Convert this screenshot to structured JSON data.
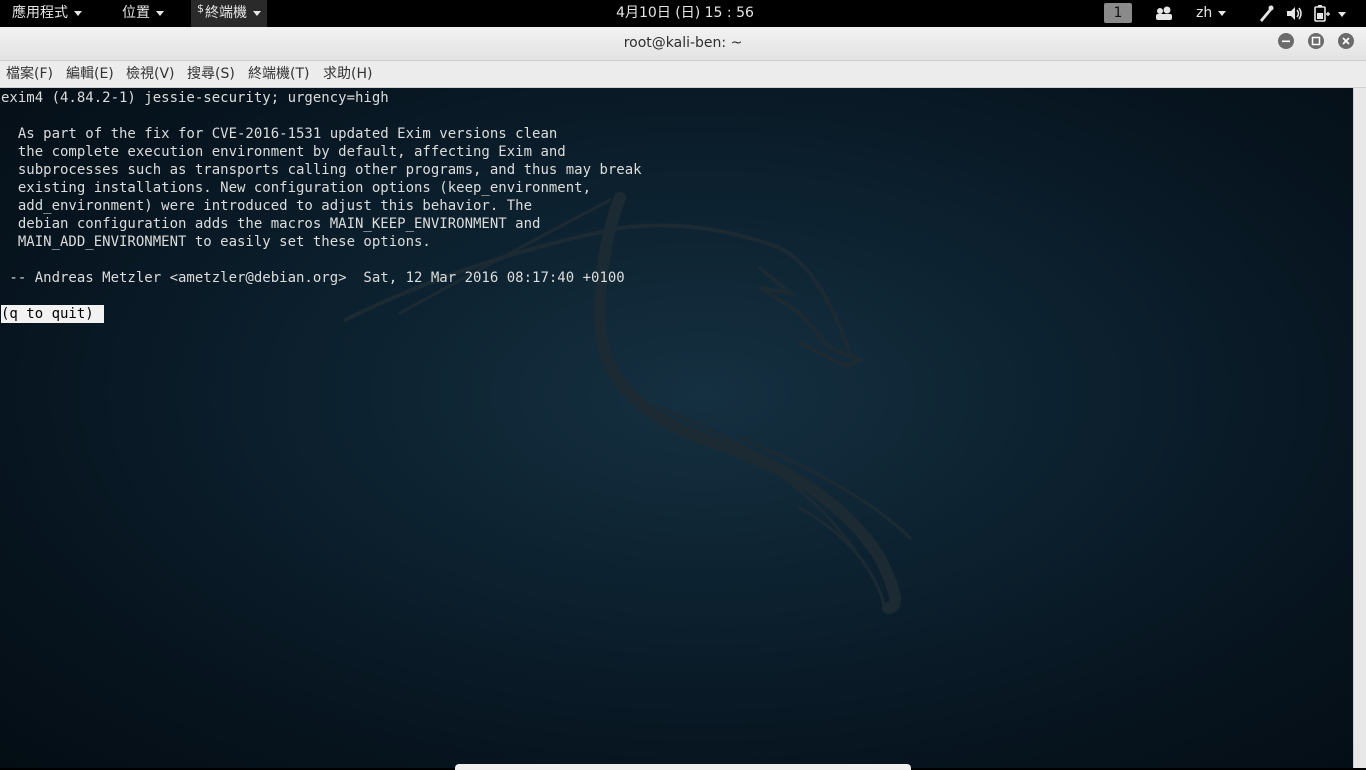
{
  "topbar": {
    "apps_label": "應用程式",
    "places_label": "位置",
    "terminal_label": "終端機",
    "terminal_dollar": "$",
    "clock": "4月10日 (日) 15 : 56",
    "workspace": "1",
    "language": "zh",
    "icons": [
      "people-icon",
      "network-icon",
      "volume-icon",
      "power-icon"
    ]
  },
  "window": {
    "title": "root@kali-ben: ~",
    "controls": [
      "minimize-icon",
      "maximize-icon",
      "close-icon"
    ]
  },
  "menu": {
    "items": [
      "檔案(F)",
      "編輯(E)",
      "檢視(V)",
      "搜尋(S)",
      "終端機(T)",
      "求助(H)"
    ]
  },
  "terminal": {
    "lines": [
      "exim4 (4.84.2-1) jessie-security; urgency=high",
      "",
      "  As part of the fix for CVE-2016-1531 updated Exim versions clean",
      "  the complete execution environment by default, affecting Exim and",
      "  subprocesses such as transports calling other programs, and thus may break",
      "  existing installations. New configuration options (keep_environment,",
      "  add_environment) were introduced to adjust this behavior. The",
      "  debian configuration adds the macros MAIN_KEEP_ENVIRONMENT and",
      "  MAIN_ADD_ENVIRONMENT to easily set these options.",
      "",
      " -- Andreas Metzler <ametzler@debian.org>  Sat, 12 Mar 2016 08:17:40 +0100"
    ],
    "prompt": "(q to quit)"
  },
  "colors": {
    "terminal_bg": "#0d2230",
    "text": "#dcdcdc",
    "topbar_bg": "#000000"
  }
}
